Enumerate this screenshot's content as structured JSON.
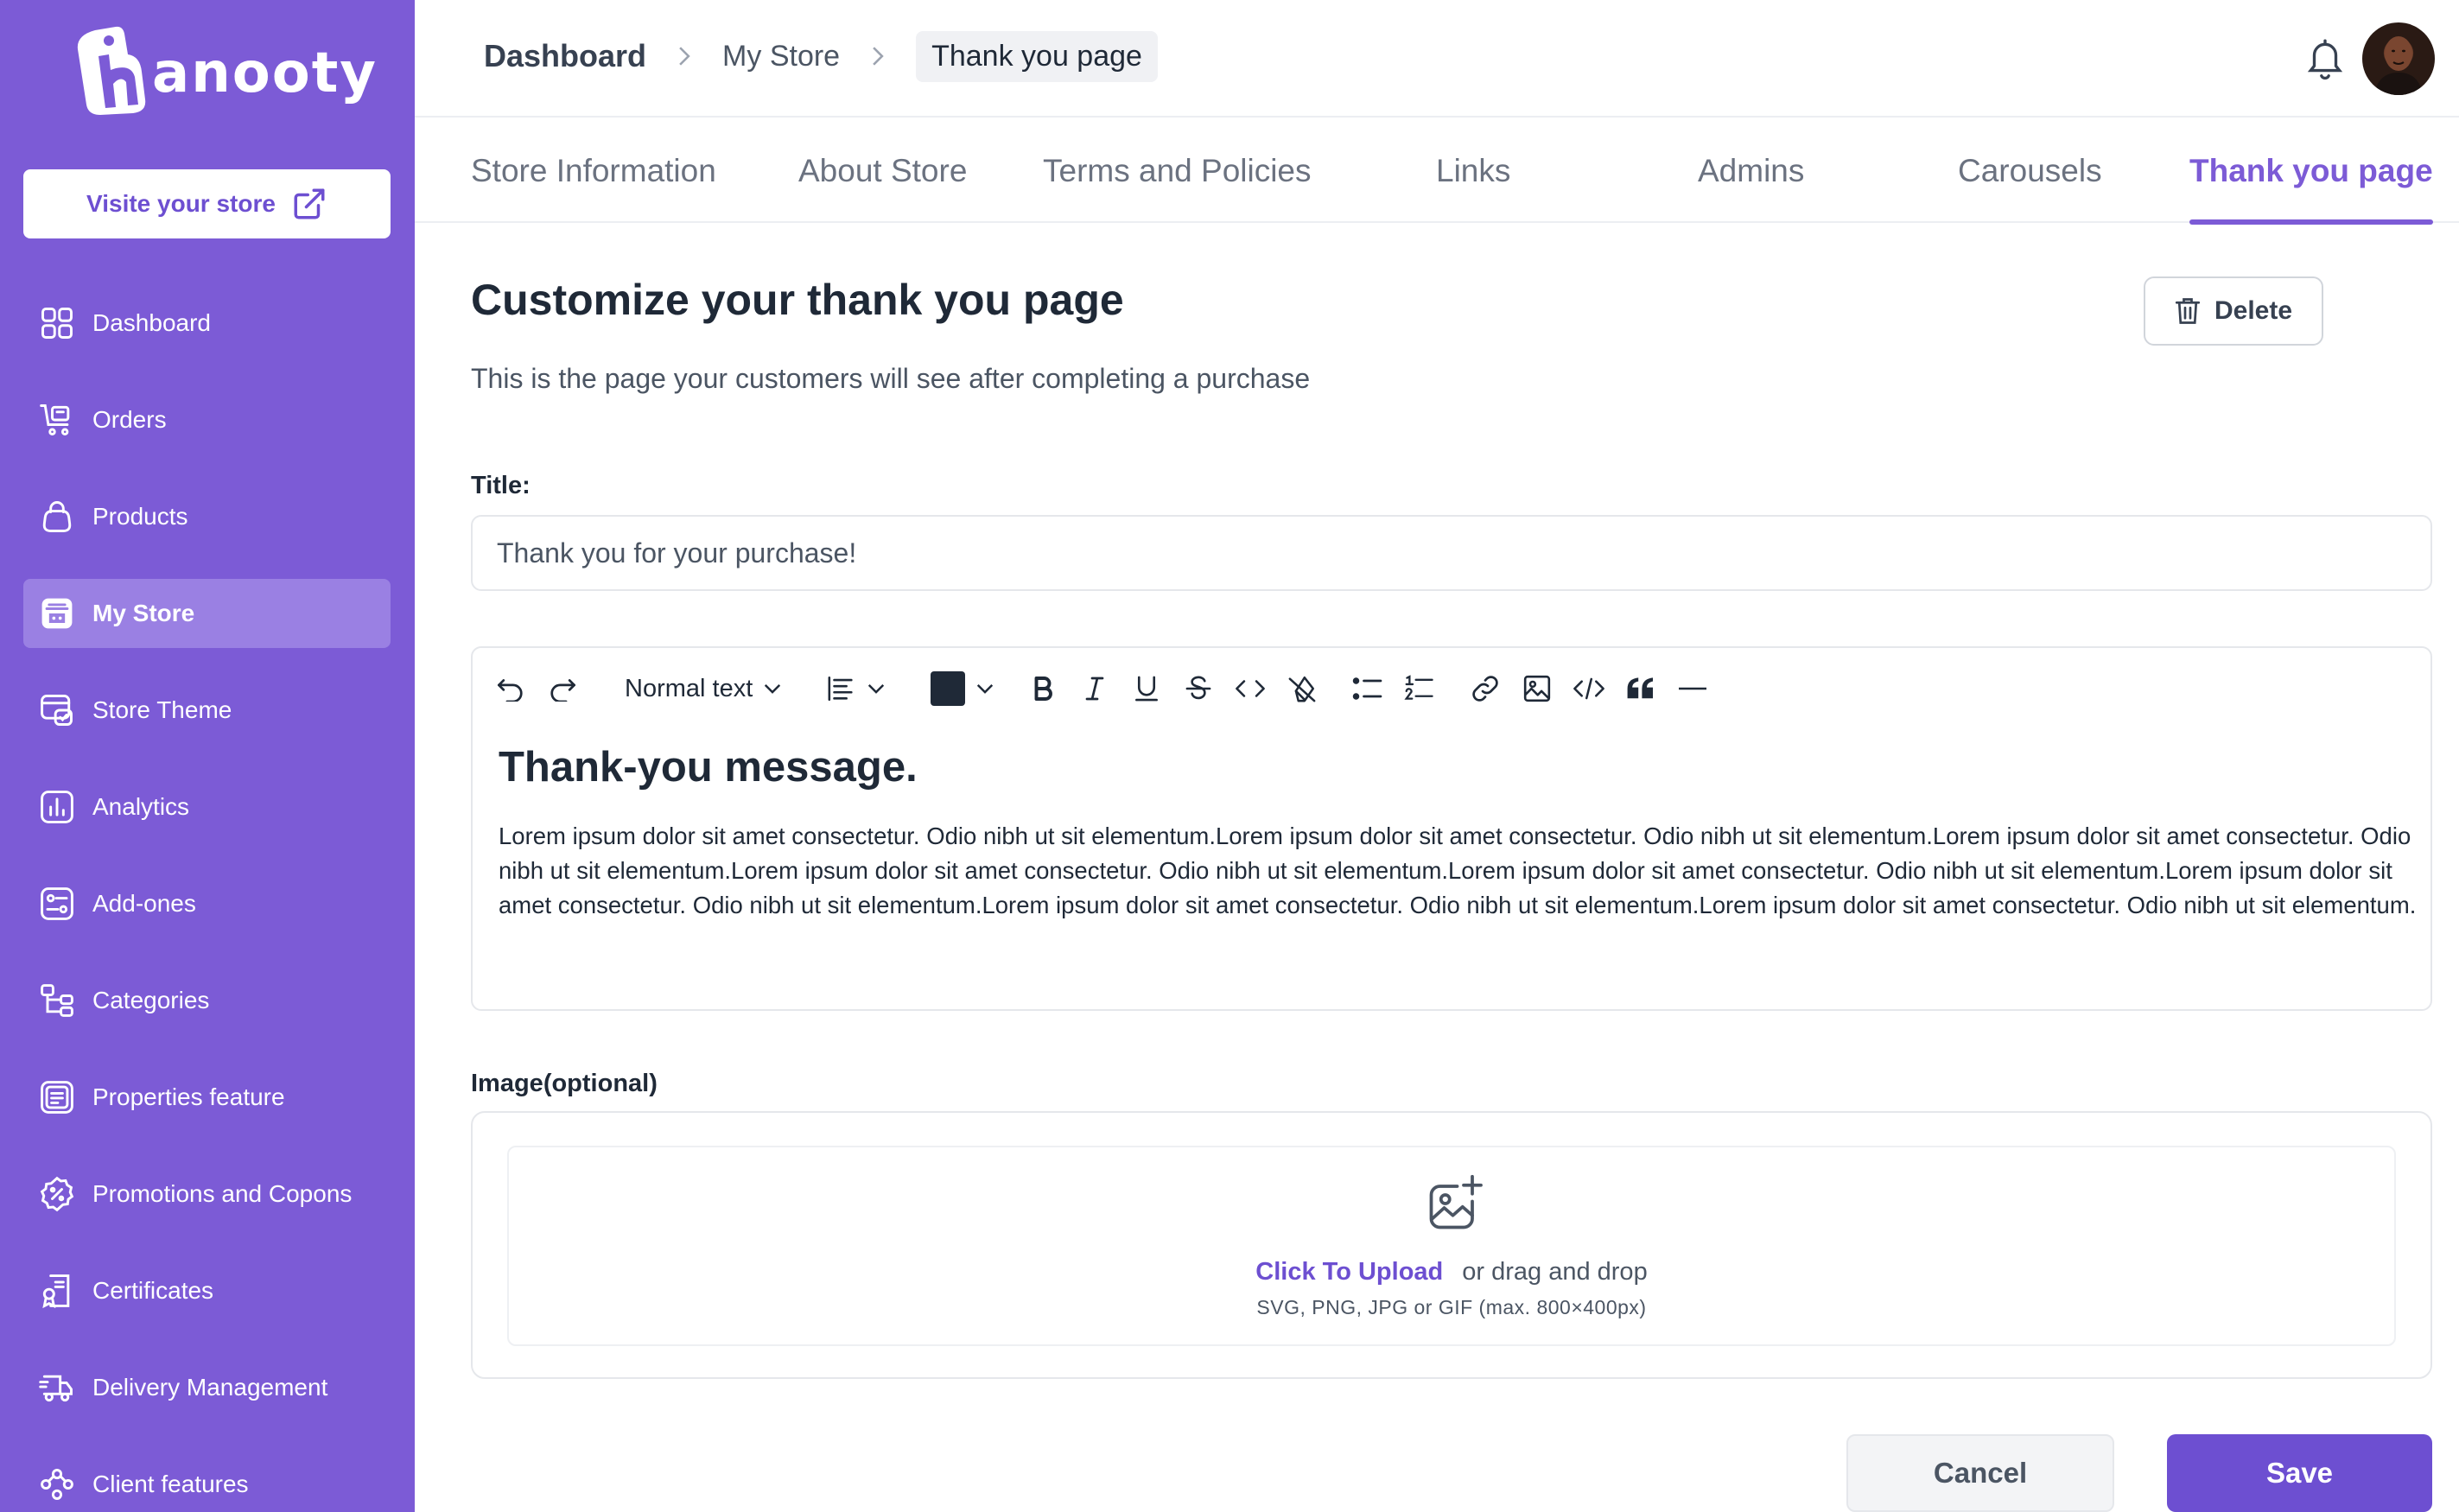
{
  "app": {
    "logo_text": "anooty"
  },
  "sidebar": {
    "visit_label": "Visite your store",
    "items": [
      {
        "label": "Dashboard",
        "icon": "grid-icon"
      },
      {
        "label": "Orders",
        "icon": "cart-icon"
      },
      {
        "label": "Products",
        "icon": "bag-icon"
      },
      {
        "label": "My Store",
        "icon": "store-icon",
        "active": true
      },
      {
        "label": "Store Theme",
        "icon": "theme-icon"
      },
      {
        "label": "Analytics",
        "icon": "analytics-icon"
      },
      {
        "label": "Add-ones",
        "icon": "addons-icon"
      },
      {
        "label": "Categories",
        "icon": "categories-icon"
      },
      {
        "label": "Properties feature",
        "icon": "properties-icon"
      },
      {
        "label": "Promotions and Copons",
        "icon": "promotion-icon"
      },
      {
        "label": "Certificates",
        "icon": "certificate-icon"
      },
      {
        "label": "Delivery Management",
        "icon": "truck-icon"
      },
      {
        "label": "Client features",
        "icon": "clients-icon"
      }
    ]
  },
  "header": {
    "breadcrumb": [
      "Dashboard",
      "My Store",
      "Thank you page"
    ]
  },
  "tabs": [
    {
      "label": "Store Information"
    },
    {
      "label": "About Store"
    },
    {
      "label": "Terms and Policies"
    },
    {
      "label": "Links"
    },
    {
      "label": "Admins"
    },
    {
      "label": "Carousels"
    },
    {
      "label": "Thank you page",
      "active": true
    }
  ],
  "main": {
    "title": "Customize your thank you page",
    "subtitle": "This is the page your customers will see after completing a purchase",
    "delete_label": "Delete",
    "title_label": "Title:",
    "title_value": "Thank you for your purchase!",
    "editor": {
      "block_type": "Normal text",
      "text_color": "#1f2937",
      "heading": "Thank-you message.",
      "body": "Lorem ipsum dolor sit amet consectetur. Odio nibh ut sit elementum.Lorem ipsum dolor sit amet consectetur. Odio nibh ut sit elementum.Lorem ipsum dolor sit amet consectetur. Odio nibh ut sit elementum.Lorem ipsum dolor sit amet consectetur. Odio nibh ut sit elementum.Lorem ipsum dolor sit amet consectetur. Odio nibh ut sit elementum.Lorem ipsum dolor sit amet consectetur. Odio nibh ut sit elementum.Lorem ipsum dolor sit amet consectetur. Odio nibh ut sit elementum.Lorem ipsum dolor sit amet consectetur. Odio nibh ut sit elementum."
    },
    "image_label": "Image(optional)",
    "upload": {
      "link": "Click To Upload",
      "text": "or drag and drop",
      "hint": "SVG, PNG, JPG or GIF (max. 800×400px)"
    },
    "cancel_label": "Cancel",
    "save_label": "Save"
  },
  "colors": {
    "brand": "#7c5bd6",
    "brand_dark": "#6d4fd1",
    "active_nav": "#9a80e3"
  }
}
